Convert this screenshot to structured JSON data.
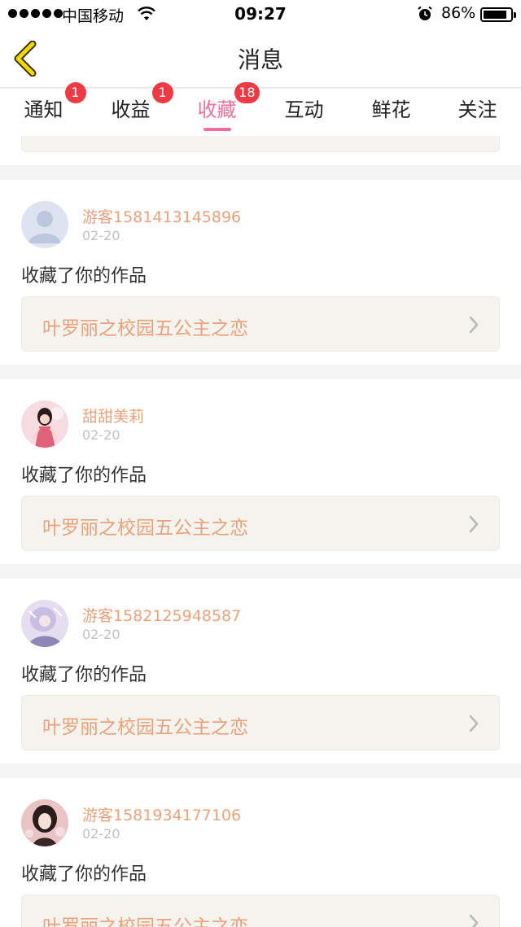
{
  "status_bar": {
    "carrier": "中国移动",
    "time": "09:27",
    "battery": "86%",
    "battery_level": 0.86
  },
  "header": {
    "title": "消息"
  },
  "tabs": [
    {
      "label": "通知",
      "badge": "1"
    },
    {
      "label": "收益",
      "badge": "1"
    },
    {
      "label": "收藏",
      "badge": "18",
      "active": true
    },
    {
      "label": "互动",
      "badge": ""
    },
    {
      "label": "鲜花",
      "badge": ""
    },
    {
      "label": "关注",
      "badge": ""
    }
  ],
  "messages": [
    {
      "user": "游客1581413145896",
      "date": "02-20",
      "action": "收藏了你的作品",
      "work": "叶罗丽之校园五公主之恋"
    },
    {
      "user": "甜甜美莉",
      "date": "02-20",
      "action": "收藏了你的作品",
      "work": "叶罗丽之校园五公主之恋"
    },
    {
      "user": "游客1582125948587",
      "date": "02-20",
      "action": "收藏了你的作品",
      "work": "叶罗丽之校园五公主之恋"
    },
    {
      "user": "游客1581934177106",
      "date": "02-20",
      "action": "收藏了你的作品",
      "work": "叶罗丽之校园五公主之恋"
    }
  ],
  "colors": {
    "accent": "#ec6f9c",
    "badge": "#ee3a45",
    "username": "#e9a27a",
    "work_box": "#f4f3ed"
  }
}
